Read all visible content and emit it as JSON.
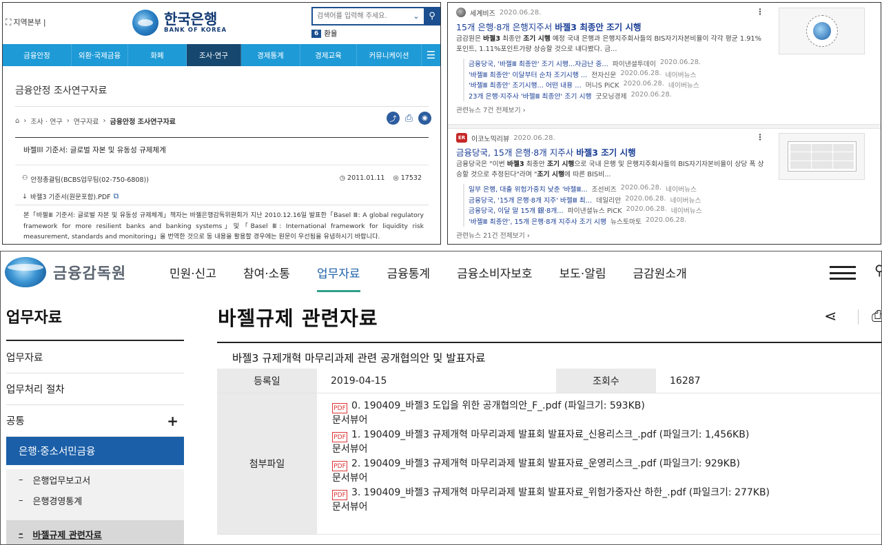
{
  "bok": {
    "region": "지역본부",
    "logo_ko": "한국은행",
    "logo_en": "BANK OF KOREA",
    "search_placeholder": "검색어를 입력해 주세요.",
    "rate_badge": "6",
    "rate_label": "환율",
    "nav": [
      "금융안정",
      "외환·국제금융",
      "화폐",
      "조사·연구",
      "경제통계",
      "경제교육",
      "커뮤니케이션"
    ],
    "page_title": "금융안정 조사연구자료",
    "breadcrumb": [
      "조사 · 연구",
      "연구자료",
      "금융안정 조사연구자료"
    ],
    "doc_title": "바젤III 기준서: 글로벌 자본 및 유동성 규제체계",
    "dept": "안정총괄팀(BCBS업무팀(02-750-6808))",
    "date": "2011.01.11",
    "views": "17532",
    "file": "바젤3 기준서(원문포함).PDF",
    "body": "본「바젤Ⅲ 기준서: 글로벌 자본 및 유동성 규제체계」책자는 바젤은행감독위원회가 지난 2010.12.16일 발표한「Basel Ⅲ: A global regulatory framework for more resilient banks and banking systems」및「Basel Ⅲ: International framework for liquidity risk measurement, standards and monitoring」을 번역한 것으로 동 내용을 활용할 경우에는 원문이 우선됨을 유념하시기 바랍니다."
  },
  "news": [
    {
      "source": "세계비즈",
      "date": "2020.06.28.",
      "title_pre": "15개 은행·8개 은행지주서 ",
      "title_bold": "바젤3 최종안 조기 시행",
      "desc_parts": [
        {
          "t": "금감원은 ",
          "b": false
        },
        {
          "t": "바젤3",
          "b": true
        },
        {
          "t": " 최종안 ",
          "b": false
        },
        {
          "t": "조기 시행",
          "b": true
        },
        {
          "t": " 예정 국내 은행과 은행지주회사들의 BIS자기자본비율이 각각 평균 1.91%포인트, 1.11%포인트가량 상승할 것으로 내다봤다. 금...",
          "b": false
        }
      ],
      "related": [
        {
          "title": "금융당국, '바젤Ⅲ 최종안' 조기 시행...자금난 중...",
          "source": "파이낸셜투데이",
          "date": "2020.06.28."
        },
        {
          "title": "'바젤Ⅲ 최종안' 이달부터 순차 조기시행 ...",
          "source": "전자신문",
          "date": "2020.06.28.",
          "extra": "네이버뉴스"
        },
        {
          "title": "'바젤Ⅲ 최종안' 조기시행... 어떤 내용 ...",
          "source": "머니S PiCK",
          "date": "2020.06.28.",
          "extra": "네이버뉴스"
        },
        {
          "title": "23개 은행·지주사 '바젤Ⅲ 최종안' 조기 시행",
          "source": "굿모닝경제",
          "date": "2020.06.28."
        }
      ],
      "more": "관련뉴스 7건 전체보기"
    },
    {
      "source": "이코노믹리뷰",
      "logo_text": "ER",
      "date": "2020.06.28.",
      "title_pre": "금융당국, 15개 은행·8개 지주사 ",
      "title_bold": "바젤3 조기 시행",
      "desc_parts": [
        {
          "t": "금융당국은 \"이번 ",
          "b": false
        },
        {
          "t": "바젤3",
          "b": true
        },
        {
          "t": " 최종안 ",
          "b": false
        },
        {
          "t": "조기 시행",
          "b": true
        },
        {
          "t": "으로 국내 은행 및 은행지주회사들의 BIS자기자본비율이 상당 폭 상승할 것으로 추정된다\"라며 \"",
          "b": false
        },
        {
          "t": "조기 시행",
          "b": true
        },
        {
          "t": "에 따른 BIS비...",
          "b": false
        }
      ],
      "related": [
        {
          "title": "일부 은행, 대출 위험가중치 낮춘 '바젤Ⅲ...",
          "source": "조선비즈",
          "date": "2020.06.28.",
          "extra": "네이버뉴스"
        },
        {
          "title": "금융당국, '15개 은행·8개 지주' 바젤Ⅲ 최...",
          "source": "데일리안",
          "date": "2020.06.28.",
          "extra": "네이버뉴스"
        },
        {
          "title": "금융당국, 이달 말 15개 銀·8개...",
          "source": "파이낸셜뉴스 PiCK",
          "date": "2020.06.28.",
          "extra": "네이버뉴스"
        },
        {
          "title": "'바젤Ⅲ 최종안', 15개 은행·8개 지주사 조기 시행",
          "source": "뉴스토마토",
          "date": "2020.06.28."
        }
      ],
      "more": "관련뉴스 21건 전체보기"
    }
  ],
  "fss": {
    "logo_text": "금융감독원",
    "nav": [
      "민원·신고",
      "참여·소통",
      "업무자료",
      "금융통계",
      "금융소비자보호",
      "보도·알림",
      "금감원소개"
    ],
    "side_title": "업무자료",
    "side_items": [
      "업무자료",
      "업무처리 절차",
      "공통"
    ],
    "side_active": "은행·중소서민금융",
    "side_sub": [
      "은행업무보고서",
      "은행경영통계",
      "바젤규제 관련자료"
    ],
    "page_title": "바젤규제 관련자료",
    "post_title": "바젤3 규제개혁 마무리과제 관련 공개협의안 및 발표자료",
    "reg_label": "등록일",
    "reg_date": "2019-04-15",
    "views_label": "조회수",
    "views": "16287",
    "attach_label": "첨부파일",
    "files": [
      "0. 190409_바젤3 도입을 위한 공개협의안_F_.pdf (파일크기: 593KB)",
      "1. 190409_바젤3 규제개혁 마무리과제 발표회 발표자료_신용리스크_.pdf (파일크기: 1,456KB)",
      "2. 190409_바젤3 규제개혁 마무리과제 발표회 발표자료_운영리스크_.pdf (파일크기: 929KB)",
      "3. 190409_바젤3 규제개혁 마무리과제 발표회 발표자료_위험가중자산 하한_.pdf (파일크기: 277KB)"
    ],
    "viewer_label": "문서뷰어"
  }
}
